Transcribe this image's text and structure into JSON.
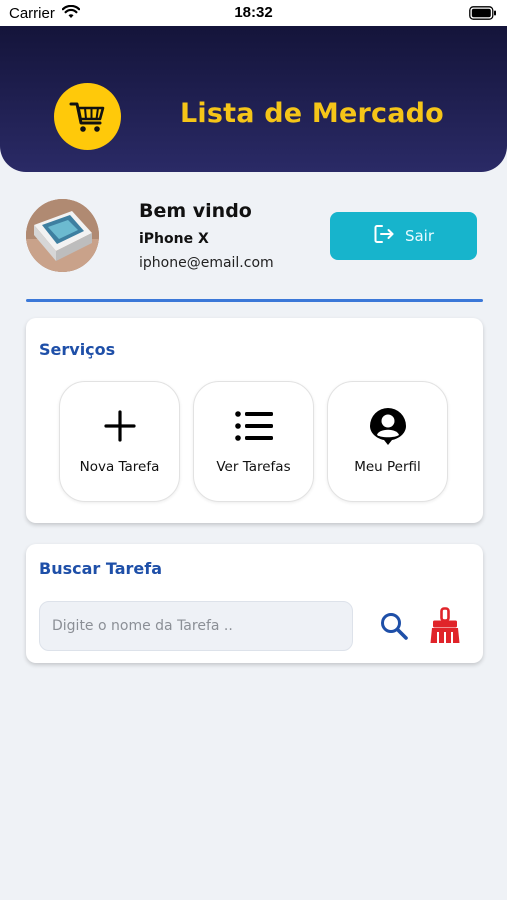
{
  "status_bar": {
    "carrier": "Carrier",
    "time": "18:32",
    "wifi_icon": "wifi-icon",
    "battery_icon": "battery-icon"
  },
  "header": {
    "title": "Lista de Mercado",
    "icon": "shopping-cart-icon",
    "colors": {
      "gradient_top": "#14143a",
      "gradient_bottom": "#2a2a66",
      "title": "#f5c518",
      "icon_bg": "#ffc90a"
    }
  },
  "profile": {
    "greeting": "Bem vindo",
    "name": "iPhone X",
    "email": "iphone@email.com",
    "logout_label": "Sair",
    "logout_icon": "logout-icon",
    "logout_color": "#17b4cc"
  },
  "services": {
    "title": "Serviços",
    "items": [
      {
        "label": "Nova Tarefa",
        "icon": "plus-icon"
      },
      {
        "label": "Ver Tarefas",
        "icon": "list-icon"
      },
      {
        "label": "Meu Perfil",
        "icon": "profile-pin-icon"
      }
    ]
  },
  "search": {
    "title": "Buscar Tarefa",
    "placeholder": "Digite o nome da Tarefa ..",
    "value": "",
    "search_icon": "search-icon",
    "clear_icon": "broom-icon",
    "colors": {
      "search": "#1e4fa8",
      "clear": "#e0242a"
    }
  },
  "accent_color": "#1e4fa8"
}
